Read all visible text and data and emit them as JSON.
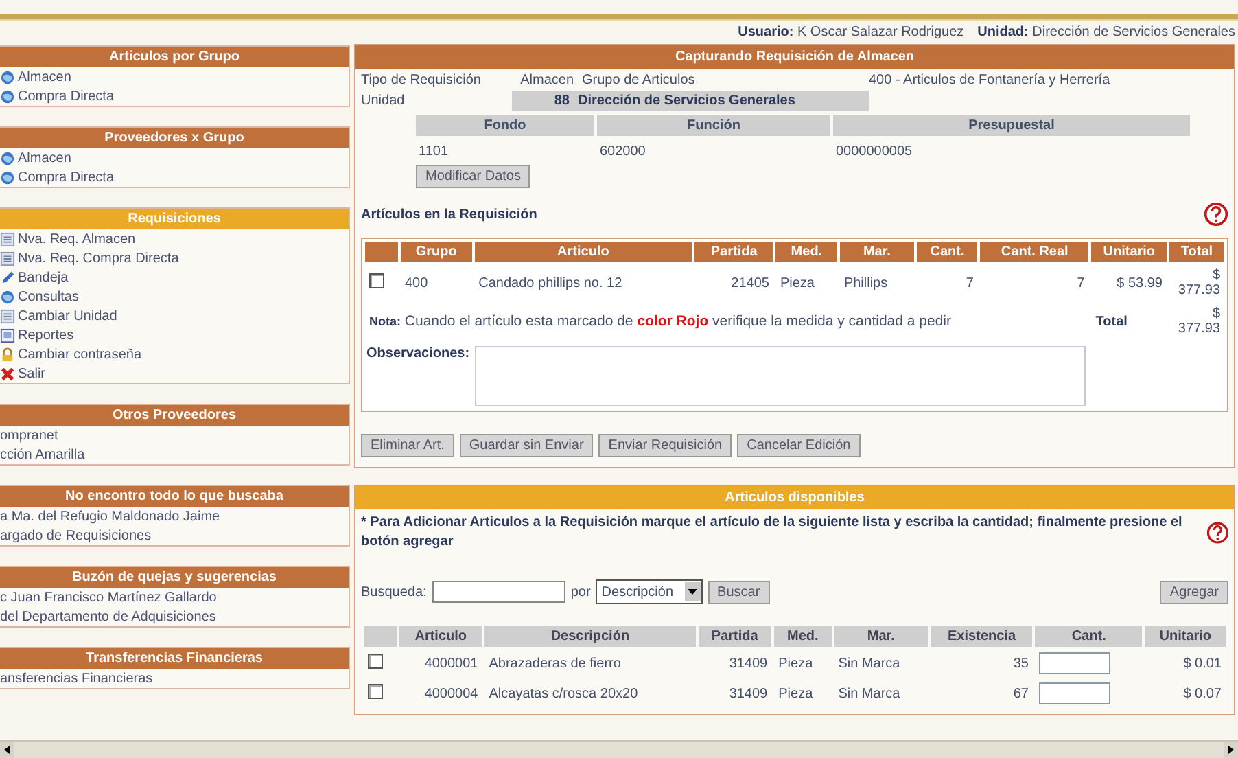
{
  "header": {
    "user_label": "Usuario:",
    "user": "K Oscar Salazar Rodriguez",
    "unit_label": "Unidad:",
    "unit": "Dirección de Servicios Generales"
  },
  "sidebar": [
    {
      "title": "Articulos por Grupo",
      "color": "#c0703a",
      "items": [
        {
          "label": "Almacen",
          "kind": "globe"
        },
        {
          "label": "Compra Directa",
          "kind": "globe"
        }
      ]
    },
    {
      "title": "Proveedores x Grupo",
      "color": "#c0703a",
      "items": [
        {
          "label": "Almacen",
          "kind": "globe"
        },
        {
          "label": "Compra Directa",
          "kind": "globe"
        }
      ]
    },
    {
      "title": "Requisiciones",
      "color": "#eba928",
      "items": [
        {
          "label": "Nva. Req. Almacen",
          "kind": "doc"
        },
        {
          "label": "Nva. Req. Compra Directa",
          "kind": "doc"
        },
        {
          "label": "Bandeja",
          "kind": "pen"
        },
        {
          "label": "Consultas",
          "kind": "globe"
        },
        {
          "label": "Cambiar Unidad",
          "kind": "doc"
        },
        {
          "label": "Reportes",
          "kind": "report"
        },
        {
          "label": "Cambiar contraseña",
          "kind": "lock"
        },
        {
          "label": "Salir",
          "kind": "cross"
        }
      ]
    },
    {
      "title": "Otros Proveedores",
      "color": "#c0703a",
      "items": [
        {
          "label": "ompranet",
          "kind": "text"
        },
        {
          "label": "cción Amarilla",
          "kind": "text"
        }
      ]
    },
    {
      "title": "No encontro todo lo que buscaba",
      "color": "#c0703a",
      "items": [
        {
          "label": "a Ma. del Refugio Maldonado Jaime",
          "kind": "text"
        },
        {
          "label": "argado de Requisiciones",
          "kind": "text"
        }
      ]
    },
    {
      "title": "Buzón de quejas y sugerencias",
      "color": "#c0703a",
      "items": [
        {
          "label": "c Juan Francisco Martínez Gallardo",
          "kind": "text"
        },
        {
          "label": "del Departamento de Adquisiciones",
          "kind": "text"
        }
      ]
    },
    {
      "title": "Transferencias Financieras",
      "color": "#c0703a",
      "items": [
        {
          "label": "ansferencias Financieras",
          "kind": "text"
        }
      ]
    }
  ],
  "requisition": {
    "title": "Capturando Requisición de Almacen",
    "tipo_label": "Tipo de Requisición",
    "tipo": "Almacen",
    "grupo_label": "Grupo de Articulos",
    "grupo": "400 - Articulos de Fontanería y Herrería",
    "unidad_label": "Unidad",
    "unidad_code": "88",
    "unidad": "Dirección de Servicios Generales",
    "budget_columns": [
      "Fondo",
      "Función",
      "Presupuestal"
    ],
    "budget_values": [
      "1101",
      "602000",
      "0000000005"
    ],
    "modify_button": "Modificar Datos",
    "items_title": "Artículos en la Requisición",
    "columns": [
      "Grupo",
      "Articulo",
      "Partida",
      "Med.",
      "Mar.",
      "Cant.",
      "Cant. Real",
      "Unitario",
      "Total"
    ],
    "rows": [
      {
        "checked": false,
        "cells": [
          "400",
          "Candado phillips no. 12",
          "21405",
          "Pieza",
          "Phillips",
          "7",
          "7",
          "$ 53.99",
          "$ 377.93"
        ]
      }
    ],
    "note_label": "Nota:",
    "note_before": "Cuando el artículo esta marcado de",
    "note_highlight": "color Rojo",
    "note_after": "verifique la medida y cantidad a pedir",
    "total_label": "Total",
    "total": "$ 377.93",
    "observations_label": "Observaciones:",
    "actions": [
      "Eliminar Art.",
      "Guardar sin Enviar",
      "Enviar Requisición",
      "Cancelar Edición"
    ]
  },
  "available": {
    "title": "Articulos disponibles",
    "instructions": "* Para Adicionar Articulos a la Requisición marque el artículo de la siguiente lista y escriba la cantidad; finalmente presione el botón agregar",
    "search_label": "Busqueda:",
    "by_label": "por",
    "by_value": "Descripción",
    "search_button": "Buscar",
    "add_button": "Agregar",
    "columns": [
      "Articulo",
      "Descripción",
      "Partida",
      "Med.",
      "Mar.",
      "Existencia",
      "Cant.",
      "Unitario"
    ],
    "rows": [
      {
        "checked": false,
        "cells": [
          "4000001",
          "Abrazaderas de fierro",
          "31409",
          "Pieza",
          "Sin Marca",
          "35",
          "$ 0.01"
        ]
      },
      {
        "checked": false,
        "cells": [
          "4000004",
          "Alcayatas c/rosca 20x20",
          "31409",
          "Pieza",
          "Sin Marca",
          "67",
          "$ 0.07"
        ]
      }
    ]
  }
}
